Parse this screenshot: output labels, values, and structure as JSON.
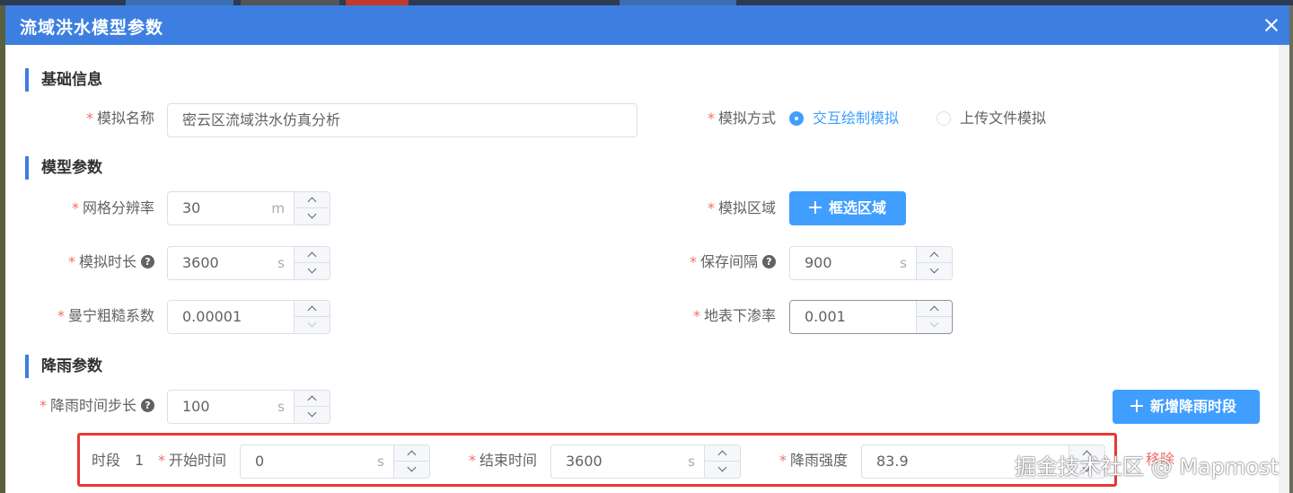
{
  "dialog": {
    "title": "流域洪水模型参数"
  },
  "sections": {
    "basic": "基础信息",
    "model": "模型参数",
    "rain": "降雨参数"
  },
  "required_mark": "*",
  "help_glyph": "?",
  "fields": {
    "sim_name": {
      "label": "模拟名称",
      "value": "密云区流域洪水仿真分析"
    },
    "sim_mode": {
      "label": "模拟方式",
      "options": [
        "交互绘制模拟",
        "上传文件模拟"
      ],
      "selected": "交互绘制模拟"
    },
    "grid_res": {
      "label": "网格分辨率",
      "value": "30",
      "unit": "m"
    },
    "sim_area": {
      "label": "模拟区域",
      "button": "框选区域"
    },
    "sim_duration": {
      "label": "模拟时长",
      "value": "3600",
      "unit": "s"
    },
    "save_interval": {
      "label": "保存间隔",
      "value": "900",
      "unit": "s"
    },
    "manning": {
      "label": "曼宁粗糙系数",
      "value": "0.00001"
    },
    "infiltration": {
      "label": "地表下渗率",
      "value": "0.001"
    },
    "rain_step": {
      "label": "降雨时间步长",
      "value": "100",
      "unit": "s"
    }
  },
  "add_rain_button": "新增降雨时段",
  "rain_period": {
    "label": "时段",
    "index": "1",
    "start": {
      "label": "开始时间",
      "value": "0",
      "unit": "s"
    },
    "end": {
      "label": "结束时间",
      "value": "3600",
      "unit": "s"
    },
    "intensity": {
      "label": "降雨强度",
      "value": "83.9"
    },
    "remove": "移除"
  },
  "watermark": "掘金技术社区 @ Mapmost",
  "colors": {
    "header": "#3d7fe0",
    "primary": "#409eff",
    "required": "#f56c6c",
    "highlight": "#e53935"
  }
}
